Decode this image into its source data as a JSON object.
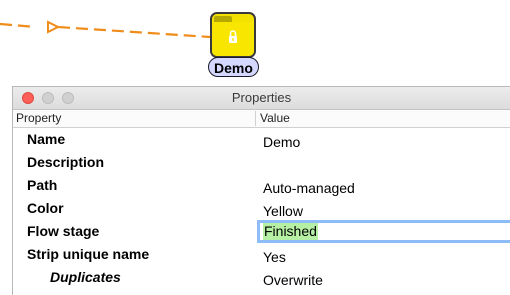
{
  "canvas": {
    "edge_color": "#f08c1a",
    "node": {
      "label": "Demo",
      "color": "#f8e600",
      "icon": "lock-icon"
    }
  },
  "window": {
    "title": "Properties",
    "buttons": [
      "close",
      "minimize",
      "zoom"
    ]
  },
  "table": {
    "headers": {
      "property": "Property",
      "value": "Value"
    },
    "rows": [
      {
        "name": "Name",
        "value": "Demo"
      },
      {
        "name": "Description",
        "value": ""
      },
      {
        "name": "Path",
        "value": "Auto-managed"
      },
      {
        "name": "Color",
        "value": "Yellow"
      },
      {
        "name": "Flow stage",
        "value": "Finished",
        "editing": true
      },
      {
        "name": "Strip unique name",
        "value": "Yes"
      },
      {
        "name": "Duplicates",
        "value": "Overwrite",
        "indented": true
      }
    ]
  },
  "colors": {
    "edit_highlight": "#b6f0a4",
    "focus_ring": "#8ebcf7",
    "label_bubble": "#d4d8ff"
  }
}
